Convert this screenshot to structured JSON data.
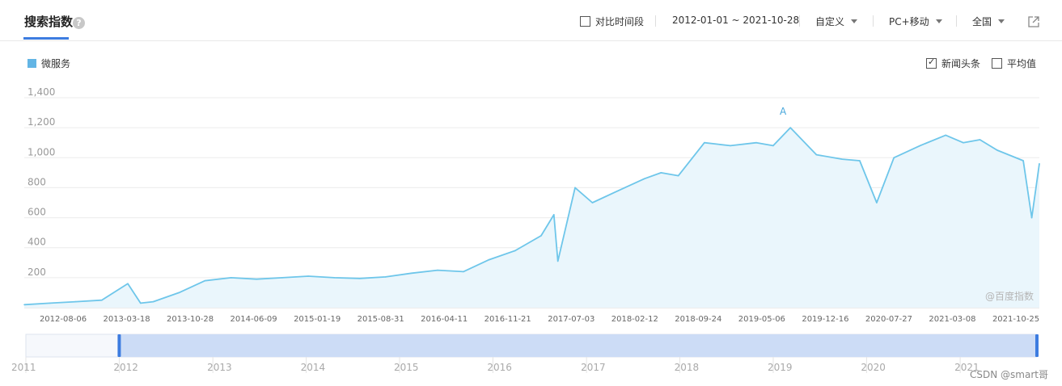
{
  "header": {
    "title": "搜索指数",
    "compare_label": "对比时间段",
    "date_range": "2012-01-01 ~ 2021-10-28",
    "custom_label": "自定义",
    "device_label": "PC+移动",
    "region_label": "全国"
  },
  "legend": {
    "series_name": "微服务"
  },
  "options": {
    "news_label": "新闻头条",
    "news_checked": true,
    "avg_label": "平均值",
    "avg_checked": false
  },
  "annotation": {
    "label": "A"
  },
  "watermark": "@百度指数",
  "credit": "CSDN @smart哥",
  "colors": {
    "line": "#6ec6ea",
    "fill": "#eaf6fc",
    "accent": "#3d7ce0",
    "navigator": "#c9daf6"
  },
  "chart_data": {
    "type": "line",
    "title": "",
    "xlabel": "",
    "ylabel": "",
    "ylim": [
      0,
      1400
    ],
    "yticks": [
      1400,
      1200,
      1000,
      800,
      600,
      400,
      200
    ],
    "ytick_labels": [
      "1,400",
      "1,200",
      "1,000",
      "800",
      "600",
      "400",
      "200"
    ],
    "xtick_labels": [
      "2012-08-06",
      "2013-03-18",
      "2013-10-28",
      "2014-06-09",
      "2015-01-19",
      "2015-08-31",
      "2016-04-11",
      "2016-11-21",
      "2017-07-03",
      "2018-02-12",
      "2018-09-24",
      "2019-05-06",
      "2019-12-16",
      "2020-07-27",
      "2021-03-08",
      "2021-10-25"
    ],
    "grid": true,
    "series": [
      {
        "name": "微服务",
        "x": [
          "2012-01-01",
          "2012-04-01",
          "2012-07-01",
          "2012-10-01",
          "2013-01-01",
          "2013-02-15",
          "2013-04-01",
          "2013-07-01",
          "2013-10-01",
          "2014-01-01",
          "2014-04-01",
          "2014-07-01",
          "2014-10-01",
          "2015-01-01",
          "2015-04-01",
          "2015-07-01",
          "2015-10-01",
          "2016-01-01",
          "2016-04-01",
          "2016-07-01",
          "2016-10-01",
          "2017-01-01",
          "2017-02-15",
          "2017-03-01",
          "2017-05-01",
          "2017-07-01",
          "2017-10-01",
          "2018-01-01",
          "2018-03-01",
          "2018-05-01",
          "2018-08-01",
          "2018-11-01",
          "2019-02-01",
          "2019-04-01",
          "2019-06-01",
          "2019-09-01",
          "2019-12-01",
          "2020-02-01",
          "2020-04-01",
          "2020-06-01",
          "2020-09-01",
          "2020-12-01",
          "2021-02-01",
          "2021-04-01",
          "2021-06-01",
          "2021-09-01",
          "2021-10-01",
          "2021-10-28"
        ],
        "y": [
          20,
          30,
          40,
          50,
          160,
          30,
          40,
          100,
          180,
          200,
          190,
          200,
          210,
          200,
          195,
          205,
          230,
          250,
          240,
          320,
          380,
          480,
          620,
          310,
          800,
          700,
          780,
          860,
          900,
          880,
          1100,
          1080,
          1100,
          1080,
          1200,
          1020,
          990,
          980,
          700,
          1000,
          1080,
          1150,
          1100,
          1120,
          1050,
          980,
          600,
          960
        ]
      }
    ],
    "annotations": [
      {
        "x": "2019-05-06",
        "label": "A"
      }
    ],
    "navigator": {
      "year_labels": [
        "2011",
        "2012",
        "2013",
        "2014",
        "2015",
        "2016",
        "2017",
        "2018",
        "2019",
        "2020",
        "2021"
      ],
      "selected_range": [
        "2012-01-01",
        "2021-10-28"
      ]
    }
  }
}
